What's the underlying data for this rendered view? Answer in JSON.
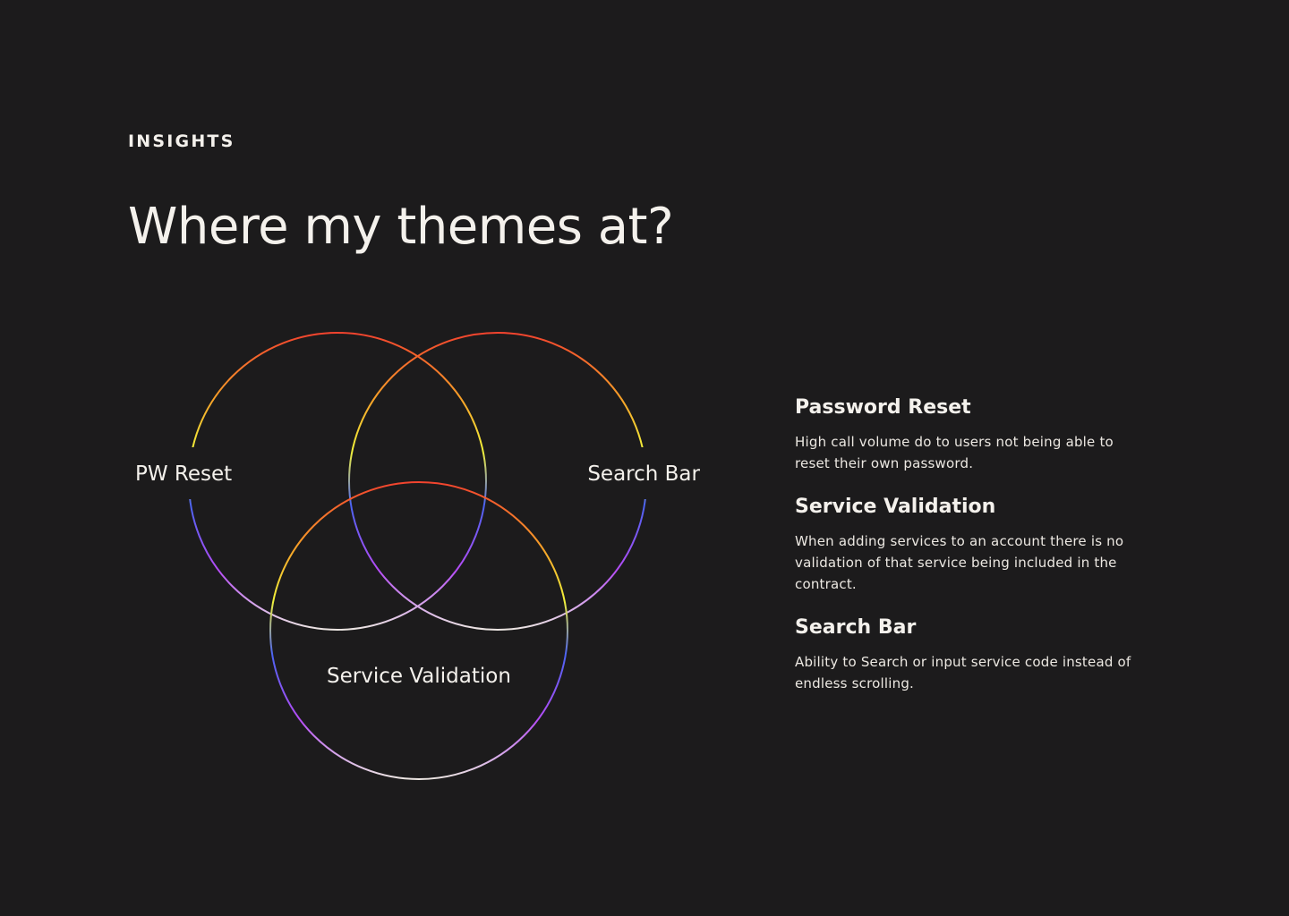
{
  "header": {
    "eyebrow": "INSIGHTS",
    "title": "Where my themes at?"
  },
  "venn": {
    "sets": [
      {
        "label": "PW Reset"
      },
      {
        "label": "Search Bar"
      },
      {
        "label": "Service Validation"
      }
    ],
    "gradient_colors": {
      "top": "#f2432e",
      "upper": "#f7a028",
      "mid": "#f1f23a",
      "lower_mid": "#4b63f2",
      "lower": "#b54cf5",
      "bottom": "#ece6e2"
    }
  },
  "insights": [
    {
      "title": "Password Reset",
      "body": "High call volume do to users not being able to reset their own password."
    },
    {
      "title": "Service Validation",
      "body": "When adding services to an account there is no validation of that service being included in the contract."
    },
    {
      "title": "Search Bar",
      "body": "Ability to Search or input service code instead of endless scrolling."
    }
  ],
  "colors": {
    "background": "#1c1b1c",
    "text": "#f4f1ec"
  }
}
